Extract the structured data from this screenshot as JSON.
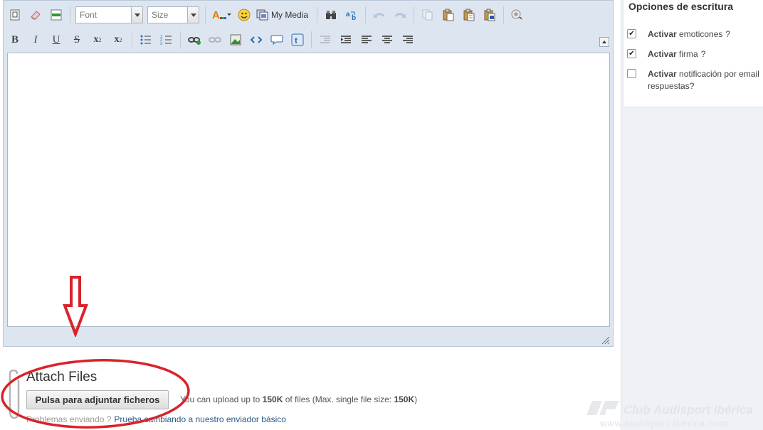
{
  "editor": {
    "font_placeholder": "Font",
    "size_placeholder": "Size",
    "my_media_label": "My Media",
    "bold_glyph": "B",
    "italic_glyph": "I",
    "underline_glyph": "U",
    "strike_glyph": "S",
    "subscript_glyph": "x",
    "subscript_mark": "2",
    "superscript_glyph": "x",
    "superscript_mark": "2",
    "text_color_glyph": "A",
    "content": ""
  },
  "sidebar": {
    "title": "Opciones de escritura",
    "options": [
      {
        "bold": "Activar",
        "text": "emoticones",
        "help": "?",
        "checked": true
      },
      {
        "bold": "Activar",
        "text": "firma",
        "help": "?",
        "checked": true
      },
      {
        "bold": "Activar",
        "text": "notificación por email",
        "text_line2": "respuestas?",
        "checked": false
      }
    ]
  },
  "attach": {
    "title": "Attach Files",
    "button_label": "Pulsa para adjuntar ficheros",
    "info_prefix": "You can upload up to",
    "info_limit": "150K",
    "info_middle": "of files (Max. single file size:",
    "info_single": "150K",
    "info_suffix": ")",
    "problems_text": "Problemas enviando ?",
    "problems_link": "Prueba cambiando a nuestro enviador básico"
  },
  "watermark": {
    "name": "Club Audisport Ibérica",
    "url": "www.audisport-iberica.com"
  },
  "colors": {
    "annotation_red": "#d9232a",
    "toolbar_bg": "#dde6f0",
    "link": "#2a5a8a"
  }
}
